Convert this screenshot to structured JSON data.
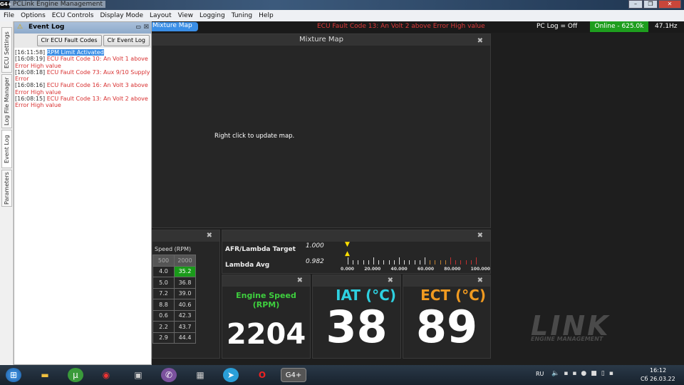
{
  "window": {
    "title": "PCLink Engine Management",
    "logo": "G4+",
    "controls": [
      "minimize",
      "restore",
      "close"
    ]
  },
  "menu": [
    "File",
    "Options",
    "ECU Controls",
    "Display Mode",
    "Layout",
    "View",
    "Logging",
    "Tuning",
    "Help"
  ],
  "side_tabs": [
    "ECU Settings",
    "Log File Manager",
    "Event Log",
    "Parameters"
  ],
  "event_log": {
    "title": "Event Log",
    "clear_fault_codes": "Clr ECU Fault Codes",
    "clear_event_log": "Clr Event Log",
    "entries": [
      {
        "time": "[16:11:58]",
        "text": "RPM Limit Activated",
        "type": "selected"
      },
      {
        "time": "[16:08:19]",
        "text": "ECU Fault Code 10: An Volt 1 above Error High value",
        "type": "error"
      },
      {
        "time": "[16:08:18]",
        "text": "ECU Fault Code 73: Aux 9/10 Supply Error",
        "type": "error"
      },
      {
        "time": "[16:08:16]",
        "text": "ECU Fault Code 16: An Volt 3 above Error High value",
        "type": "error"
      },
      {
        "time": "[16:08:15]",
        "text": "ECU Fault Code 13: An Volt 2 above Error High value",
        "type": "error"
      }
    ]
  },
  "status": {
    "active_tab": "Mixture Map",
    "fault": "ECU Fault Code 13: An Volt 2 above Error High value",
    "pc_log": "PC Log = Off",
    "online": "Online - 625.0k",
    "rate": "47.1Hz"
  },
  "mixture_map": {
    "title": "Mixture Map",
    "hint": "Right click to update map."
  },
  "table": {
    "axis": "Speed (RPM)",
    "columns": [
      "500",
      "2000"
    ],
    "rows": [
      [
        "4.0",
        "35.2"
      ],
      [
        "5.0",
        "36.8"
      ],
      [
        "7.2",
        "39.0"
      ],
      [
        "8.8",
        "40.6"
      ],
      [
        "0.6",
        "42.3"
      ],
      [
        "2.2",
        "43.7"
      ],
      [
        "2.9",
        "44.4"
      ]
    ]
  },
  "lambda": {
    "target_label": "AFR/Lambda Target",
    "target_value": "1.000",
    "avg_label": "Lambda Avg",
    "avg_value": "0.982",
    "scale": [
      "0.000",
      "20.000",
      "40.000",
      "60.000",
      "80.000",
      "100.000"
    ]
  },
  "gauges": [
    {
      "label": "Engine Speed (RPM)",
      "value": "2204",
      "color": "#3ecf3e"
    },
    {
      "label": "IAT (°C)",
      "value": "38",
      "color": "#2ed0e0"
    },
    {
      "label": "ECT (°C)",
      "value": "89",
      "color": "#f09a20"
    }
  ],
  "brand": {
    "name": "LINK",
    "tagline": "ENGINE MANAGEMENT"
  },
  "tray": {
    "lang": "RU",
    "time": "16:12",
    "date": "Сб 26.03.22"
  }
}
